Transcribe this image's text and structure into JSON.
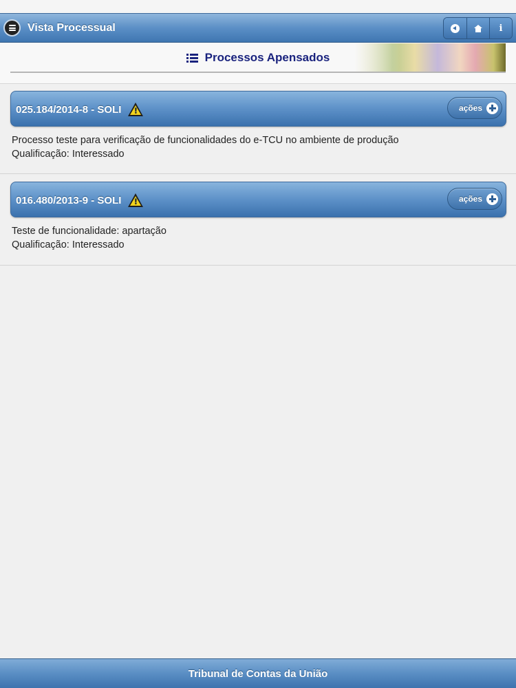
{
  "header": {
    "title": "Vista Processual",
    "menu_icon": "menu-icon",
    "buttons": [
      {
        "icon": "back-icon"
      },
      {
        "icon": "home-icon"
      },
      {
        "icon": "info-icon",
        "glyph": "i"
      }
    ]
  },
  "page": {
    "title": "Processos Apensados",
    "title_icon": "list-icon"
  },
  "processes": [
    {
      "number": "025.184/2014-8 - SOLI",
      "warning_icon": "warning-icon",
      "actions_label": "ações",
      "description": "Processo teste para verificação de funcionalidades do e-TCU no ambiente de produção",
      "qualification": "Qualificação: Interessado"
    },
    {
      "number": "016.480/2013-9 - SOLI",
      "warning_icon": "warning-icon",
      "actions_label": "ações",
      "description": "Teste de funcionalidade: apartação",
      "qualification": "Qualificação: Interessado"
    }
  ],
  "footer": {
    "text": "Tribunal de Contas da União"
  },
  "colors": {
    "bar_blue": "#5d91c8",
    "title_navy": "#1a237e",
    "warning_yellow": "#f2d21b"
  }
}
